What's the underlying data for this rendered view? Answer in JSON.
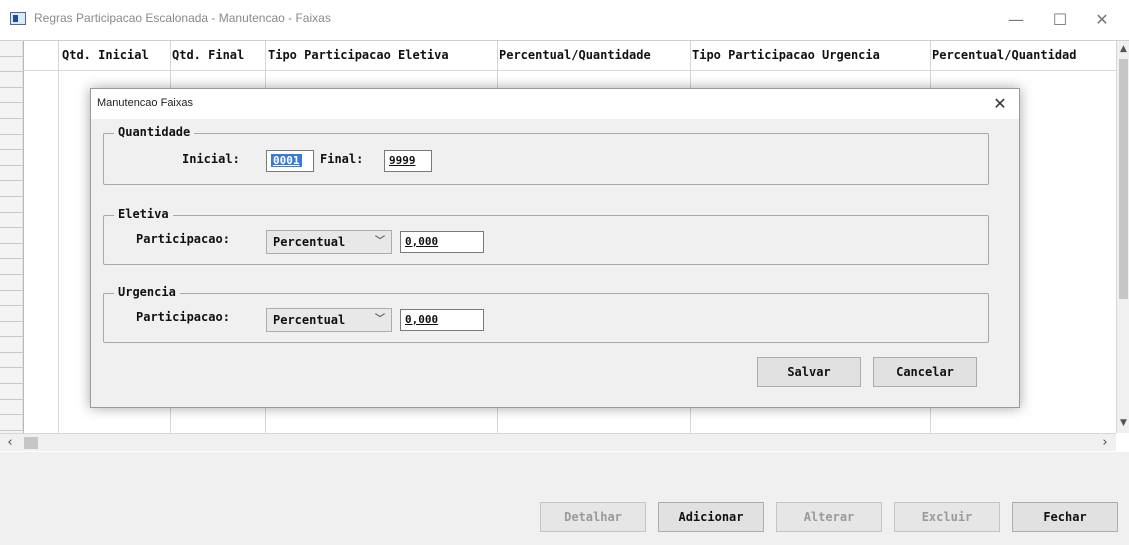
{
  "window": {
    "title": "Regras Participacao Escalonada - Manutencao - Faixas",
    "minimize": "—",
    "maximize": "☐",
    "close": "✕"
  },
  "grid": {
    "columns": [
      "Qtd. Inicial",
      "Qtd. Final",
      "Tipo Participacao Eletiva",
      "Percentual/Quantidade",
      "Tipo Participacao Urgencia",
      "Percentual/Quantidad"
    ]
  },
  "buttons": {
    "detalhar": "Detalhar",
    "adicionar": "Adicionar",
    "alterar": "Alterar",
    "excluir": "Excluir",
    "fechar": "Fechar"
  },
  "dialog": {
    "title": "Manutencao Faixas",
    "close": "✕",
    "quantidade": {
      "legend": "Quantidade",
      "inicial_label": "Inicial:",
      "inicial_value": "0001",
      "final_label": "Final:",
      "final_value": "9999"
    },
    "eletiva": {
      "legend": "Eletiva",
      "participacao_label": "Participacao:",
      "tipo_value": "Percentual",
      "valor": "0,000"
    },
    "urgencia": {
      "legend": "Urgencia",
      "participacao_label": "Participacao:",
      "tipo_value": "Percentual",
      "valor": "0,000"
    },
    "salvar": "Salvar",
    "cancelar": "Cancelar"
  },
  "colors": {
    "selection": "#3a7bd5",
    "disabled_text": "#9a9a9a"
  }
}
